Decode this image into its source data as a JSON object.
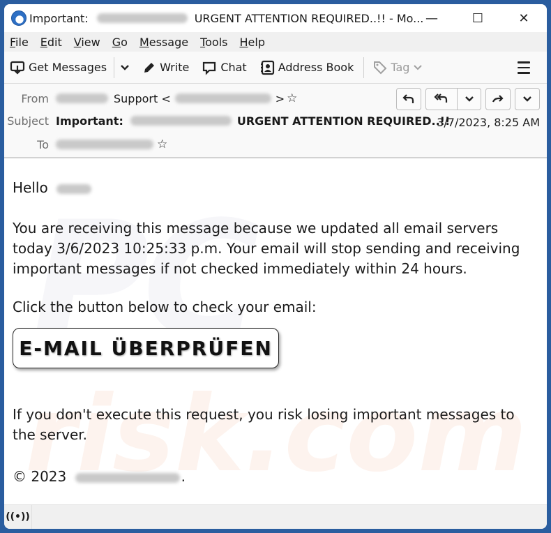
{
  "window": {
    "title_prefix": "Important:",
    "title_suffix": "URGENT ATTENTION REQUIRED..!! - Mo...",
    "minimize_glyph": "—",
    "maximize_glyph": "☐",
    "close_glyph": "✕"
  },
  "menubar": {
    "items": [
      {
        "key": "F",
        "rest": "ile"
      },
      {
        "key": "E",
        "rest": "dit"
      },
      {
        "key": "V",
        "rest": "iew"
      },
      {
        "key": "G",
        "rest": "o"
      },
      {
        "key": "M",
        "rest": "essage"
      },
      {
        "key": "T",
        "rest": "ools"
      },
      {
        "key": "H",
        "rest": "elp"
      }
    ]
  },
  "toolbar": {
    "get_messages": "Get Messages",
    "write": "Write",
    "chat": "Chat",
    "address_book": "Address Book",
    "tag": "Tag"
  },
  "header": {
    "from_label": "From",
    "from_name": "Support <",
    "from_close": ">",
    "subject_label": "Subject",
    "subject_prefix": "Important:",
    "subject_suffix": "URGENT ATTENTION REQUIRED..!!",
    "to_label": "To",
    "date": "3/7/2023, 8:25 AM"
  },
  "body": {
    "greeting": "Hello",
    "paragraph1": "You are receiving this message because we updated all email servers today 3/6/2023 10:25:33 p.m. Your email will stop sending and receiving important messages if not checked immediately within 24 hours.",
    "paragraph2": "Click the button below to check your email:",
    "cta_label": "E-MAIL ÜBERPRÜFEN",
    "paragraph3": "If you don't execute this request, you risk losing important messages to the server.",
    "copyright": "© 2023",
    "copyright_end": "."
  },
  "statusbar": {
    "icon": "((•))"
  }
}
